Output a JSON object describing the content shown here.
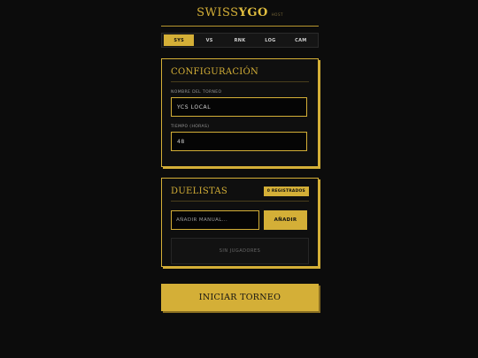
{
  "header": {
    "logo_light": "SWISS",
    "logo_bold": "YGO",
    "host": "HOST"
  },
  "tabs": [
    {
      "label": "SYS",
      "active": true
    },
    {
      "label": "VS",
      "active": false
    },
    {
      "label": "RNK",
      "active": false
    },
    {
      "label": "LOG",
      "active": false
    },
    {
      "label": "CAM",
      "active": false
    }
  ],
  "config": {
    "title": "CONFIGURACIÓN",
    "name_label": "NOMBRE DEL TORNEO",
    "name_value": "YCS LOCAL",
    "time_label": "TIEMPO (HORAS)",
    "time_value": "48"
  },
  "players": {
    "title": "DUELISTAS",
    "count_badge": "0 REGISTRADOS",
    "add_placeholder": "AÑADIR MANUAL...",
    "add_button": "AÑADIR",
    "empty_text": "SIN JUGADORES"
  },
  "start_button": "INICIAR TORNEO",
  "colors": {
    "accent": "#d4af37",
    "background": "#0c0c0c"
  }
}
